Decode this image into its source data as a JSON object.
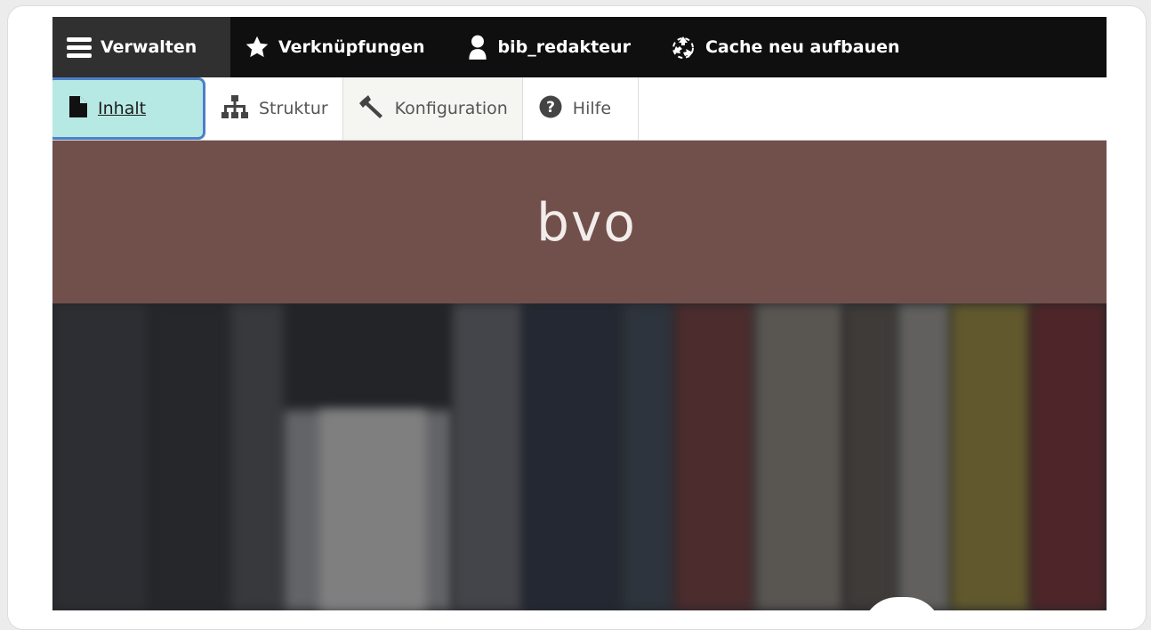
{
  "toolbar": {
    "items": [
      {
        "label": "Verwalten",
        "icon": "menu-icon"
      },
      {
        "label": "Verknüpfungen",
        "icon": "star-icon"
      },
      {
        "label": "bib_redakteur",
        "icon": "user-icon"
      },
      {
        "label": "Cache neu aufbauen",
        "icon": "recycle-icon"
      }
    ]
  },
  "tray": {
    "items": [
      {
        "label": "Inhalt",
        "icon": "document-icon"
      },
      {
        "label": "Struktur",
        "icon": "sitemap-icon"
      },
      {
        "label": "Konfiguration",
        "icon": "wrench-icon"
      },
      {
        "label": "Hilfe",
        "icon": "help-icon"
      }
    ]
  },
  "brand": {
    "logo_text": "bvo"
  },
  "colors": {
    "toolbar_bg": "#0f0f0f",
    "active_tray_bg": "#b7e9e4",
    "focus_ring": "#4e7fc9",
    "brand_bg": "#71504c"
  }
}
